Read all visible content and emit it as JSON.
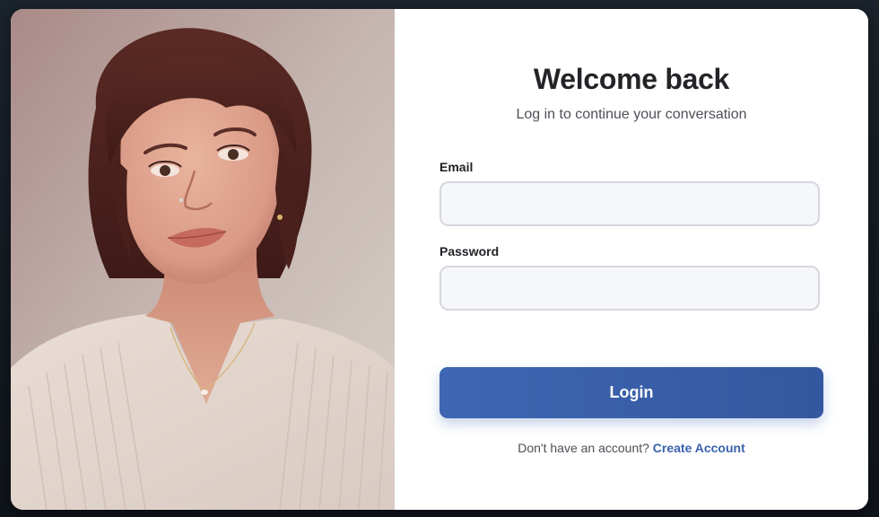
{
  "login": {
    "title": "Welcome back",
    "subtitle": "Log in to continue your conversation",
    "email_label": "Email",
    "email_value": "",
    "password_label": "Password",
    "password_value": "",
    "login_label": "Login",
    "signup_prompt": "Don't have an account?",
    "signup_link": "Create Account"
  },
  "colors": {
    "accent": "#3e66b3",
    "link": "#3a62ad",
    "input_bg": "#f6f7f9",
    "input_border": "#d6d7de"
  }
}
